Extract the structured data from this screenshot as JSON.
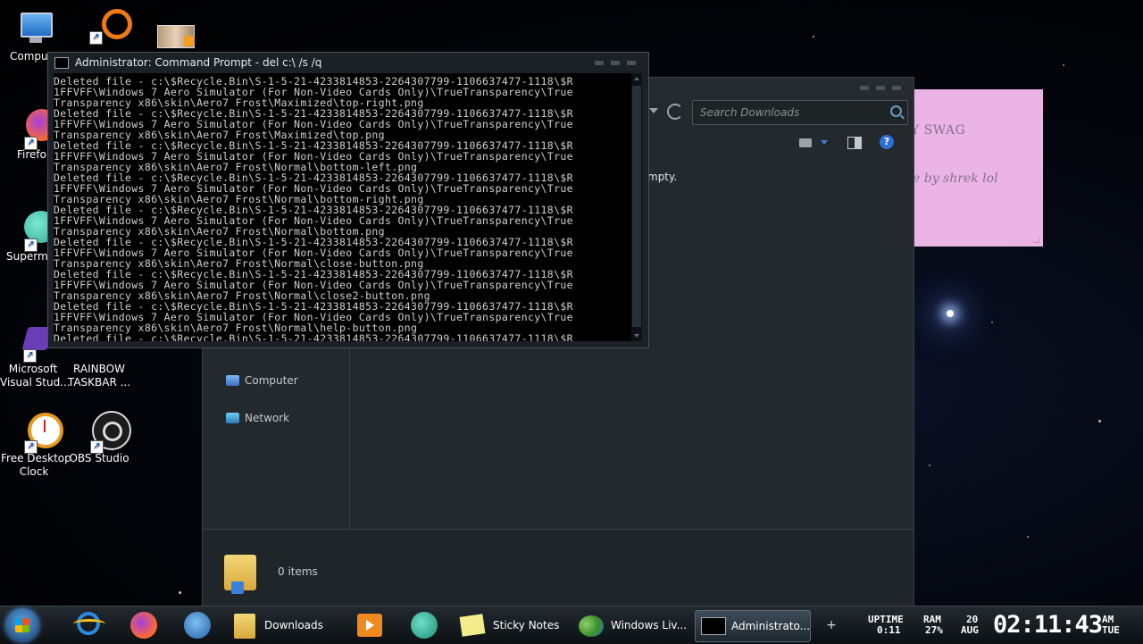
{
  "desktop": {
    "icons": [
      {
        "label": "Compu"
      },
      {
        "label": "Firefo"
      },
      {
        "label": "Supermi"
      },
      {
        "label": "Microsoft\nVisual Stud..."
      },
      {
        "label": "RAINBOW\nTASKBAR ..."
      },
      {
        "label": "Free Desktop\nClock"
      },
      {
        "label": "OBS Studio"
      }
    ]
  },
  "sticky_note": {
    "line1": "Y SWAG",
    "line2": "e by shrek lol",
    "color": "#eab5e4"
  },
  "explorer": {
    "search_placeholder": "Search Downloads",
    "empty_message_partial": "mpty.",
    "nav": [
      {
        "label": "Computer"
      },
      {
        "label": "Network"
      }
    ],
    "item_count": "0 items"
  },
  "cmd": {
    "title": "Administrator:  Command Prompt - del  c:\\ /s /q",
    "lines": [
      "Deleted file - c:\\$Recycle.Bin\\S-1-5-21-4233814853-2264307799-1106637477-1118\\$R",
      "1FFVFF\\Windows 7 Aero Simulator (For Non-Video Cards Only)\\TrueTransparency\\True",
      "Transparency x86\\skin\\Aero7 Frost\\Maximized\\top-right.png",
      "Deleted file - c:\\$Recycle.Bin\\S-1-5-21-4233814853-2264307799-1106637477-1118\\$R",
      "1FFVFF\\Windows 7 Aero Simulator (For Non-Video Cards Only)\\TrueTransparency\\True",
      "Transparency x86\\skin\\Aero7 Frost\\Maximized\\top.png",
      "Deleted file - c:\\$Recycle.Bin\\S-1-5-21-4233814853-2264307799-1106637477-1118\\$R",
      "1FFVFF\\Windows 7 Aero Simulator (For Non-Video Cards Only)\\TrueTransparency\\True",
      "Transparency x86\\skin\\Aero7 Frost\\Normal\\bottom-left.png",
      "Deleted file - c:\\$Recycle.Bin\\S-1-5-21-4233814853-2264307799-1106637477-1118\\$R",
      "1FFVFF\\Windows 7 Aero Simulator (For Non-Video Cards Only)\\TrueTransparency\\True",
      "Transparency x86\\skin\\Aero7 Frost\\Normal\\bottom-right.png",
      "Deleted file - c:\\$Recycle.Bin\\S-1-5-21-4233814853-2264307799-1106637477-1118\\$R",
      "1FFVFF\\Windows 7 Aero Simulator (For Non-Video Cards Only)\\TrueTransparency\\True",
      "Transparency x86\\skin\\Aero7 Frost\\Normal\\bottom.png",
      "Deleted file - c:\\$Recycle.Bin\\S-1-5-21-4233814853-2264307799-1106637477-1118\\$R",
      "1FFVFF\\Windows 7 Aero Simulator (For Non-Video Cards Only)\\TrueTransparency\\True",
      "Transparency x86\\skin\\Aero7 Frost\\Normal\\close-button.png",
      "Deleted file - c:\\$Recycle.Bin\\S-1-5-21-4233814853-2264307799-1106637477-1118\\$R",
      "1FFVFF\\Windows 7 Aero Simulator (For Non-Video Cards Only)\\TrueTransparency\\True",
      "Transparency x86\\skin\\Aero7 Frost\\Normal\\close2-button.png",
      "Deleted file - c:\\$Recycle.Bin\\S-1-5-21-4233814853-2264307799-1106637477-1118\\$R",
      "1FFVFF\\Windows 7 Aero Simulator (For Non-Video Cards Only)\\TrueTransparency\\True",
      "Transparency x86\\skin\\Aero7 Frost\\Normal\\help-button.png",
      "Deleted file - c:\\$Recycle.Bin\\S-1-5-21-4233814853-2264307799-1106637477-1118\\$R"
    ]
  },
  "taskbar": {
    "buttons": [
      {
        "label": "Downloads"
      },
      {
        "label": "Sticky Notes"
      },
      {
        "label": "Windows Liv..."
      },
      {
        "label": "Administrato..."
      }
    ],
    "stats": {
      "uptime_label": "UPTIME",
      "uptime_value": "0:11",
      "ram_label": "RAM",
      "ram_value": "27%",
      "day": "20",
      "month": "AUG",
      "clock": "02:11:43",
      "ampm": "AM",
      "weekday": "TUE"
    }
  }
}
